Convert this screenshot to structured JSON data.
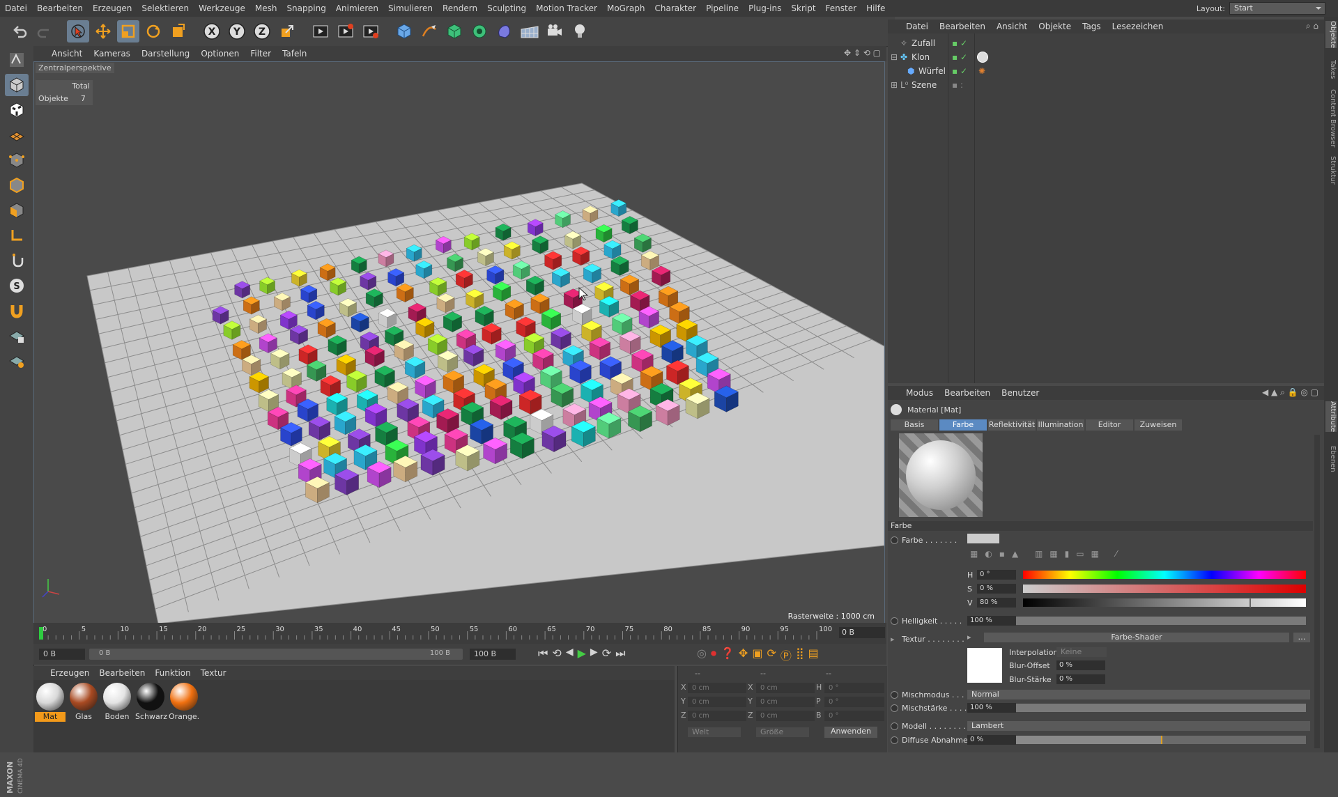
{
  "menubar": {
    "items": [
      "Datei",
      "Bearbeiten",
      "Erzeugen",
      "Selektieren",
      "Werkzeuge",
      "Mesh",
      "Snapping",
      "Animieren",
      "Simulieren",
      "Rendern",
      "Sculpting",
      "Motion Tracker",
      "MoGraph",
      "Charakter",
      "Pipeline",
      "Plug-ins",
      "Skript",
      "Fenster",
      "Hilfe"
    ],
    "layout_label": "Layout:",
    "layout_value": "Start"
  },
  "viewport": {
    "menu": [
      "Ansicht",
      "Kameras",
      "Darstellung",
      "Optionen",
      "Filter",
      "Tafeln"
    ],
    "camera_label": "Zentralperspektive",
    "hud_total": "Total",
    "hud_objects_label": "Objekte",
    "hud_objects_value": "7",
    "raster": "Rasterweite : 1000 cm",
    "grid_color": "#c8c8c8",
    "line_color": "#8c8c8c"
  },
  "timeline": {
    "ticks": [
      "0",
      "5",
      "10",
      "15",
      "20",
      "25",
      "30",
      "35",
      "40",
      "45",
      "50",
      "55",
      "60",
      "65",
      "70",
      "75",
      "80",
      "85",
      "90",
      "95",
      "100"
    ],
    "current_frame": "0 B",
    "start": "0 B",
    "range_start": "0 B",
    "range_end": "100 B",
    "end": "100 B"
  },
  "materials": {
    "menu": [
      "Erzeugen",
      "Bearbeiten",
      "Funktion",
      "Textur"
    ],
    "items": [
      {
        "name": "Mat",
        "color": "#d8d8d8"
      },
      {
        "name": "Glas",
        "color": "#a84a22"
      },
      {
        "name": "Boden",
        "color": "#e4e4e4"
      },
      {
        "name": "Schwarz",
        "color": "#111111"
      },
      {
        "name": "Orange.",
        "color": "#f07010"
      }
    ]
  },
  "coords": {
    "header": [
      "--",
      "--",
      "--"
    ],
    "rows": [
      {
        "a": "X",
        "av": "0 cm",
        "b": "X",
        "bv": "0 cm",
        "c": "H",
        "cv": "0 °"
      },
      {
        "a": "Y",
        "av": "0 cm",
        "b": "Y",
        "bv": "0 cm",
        "c": "P",
        "cv": "0 °"
      },
      {
        "a": "Z",
        "av": "0 cm",
        "b": "Z",
        "bv": "0 cm",
        "c": "B",
        "cv": "0 °"
      }
    ],
    "world": "Welt",
    "size": "Größe",
    "apply": "Anwenden"
  },
  "objects": {
    "menu": [
      "Datei",
      "Bearbeiten",
      "Ansicht",
      "Objekte",
      "Tags",
      "Lesezeichen"
    ],
    "items": [
      "Zufall",
      "Klon",
      "Würfel",
      "Szene"
    ]
  },
  "right_tabs": [
    "Objekte",
    "Takes",
    "Content Browser",
    "Struktur",
    "Attribute",
    "Ebenen"
  ],
  "attributes": {
    "menu": [
      "Modus",
      "Bearbeiten",
      "Benutzer"
    ],
    "title": "Material [Mat]",
    "tabs": [
      "Basis",
      "Farbe",
      "Reflektivität",
      "Illumination",
      "Editor",
      "Zuweisen"
    ],
    "section": "Farbe",
    "color_label": "Farbe . . . . . . .",
    "h_label": "H",
    "h_value": "0 °",
    "s_label": "S",
    "s_value": "0 %",
    "v_label": "V",
    "v_value": "80 %",
    "v_level": 0.8,
    "brightness_label": "Helligkeit . . . . .",
    "brightness_value": "100 %",
    "texture_label": "Textur . . . . . . . .",
    "texture_value": "Farbe-Shader",
    "interp_label": "Interpolation",
    "interp_value": "Keine",
    "bluroffset_label": "Blur-Offset",
    "bluroffset_value": "0 %",
    "blurstrength_label": "Blur-Stärke",
    "blurstrength_value": "0 %",
    "mixmode_label": "Mischmodus . . . . .",
    "mixmode_value": "Normal",
    "mixstrength_label": "Mischstärke . . . . .",
    "mixstrength_value": "100 %",
    "model_label": "Modell . . . . . . . .",
    "model_value": "Lambert",
    "diffuse_label": "Diffuse Abnahme",
    "diffuse_value": "0 %",
    "diffuse_level": 0.5
  }
}
